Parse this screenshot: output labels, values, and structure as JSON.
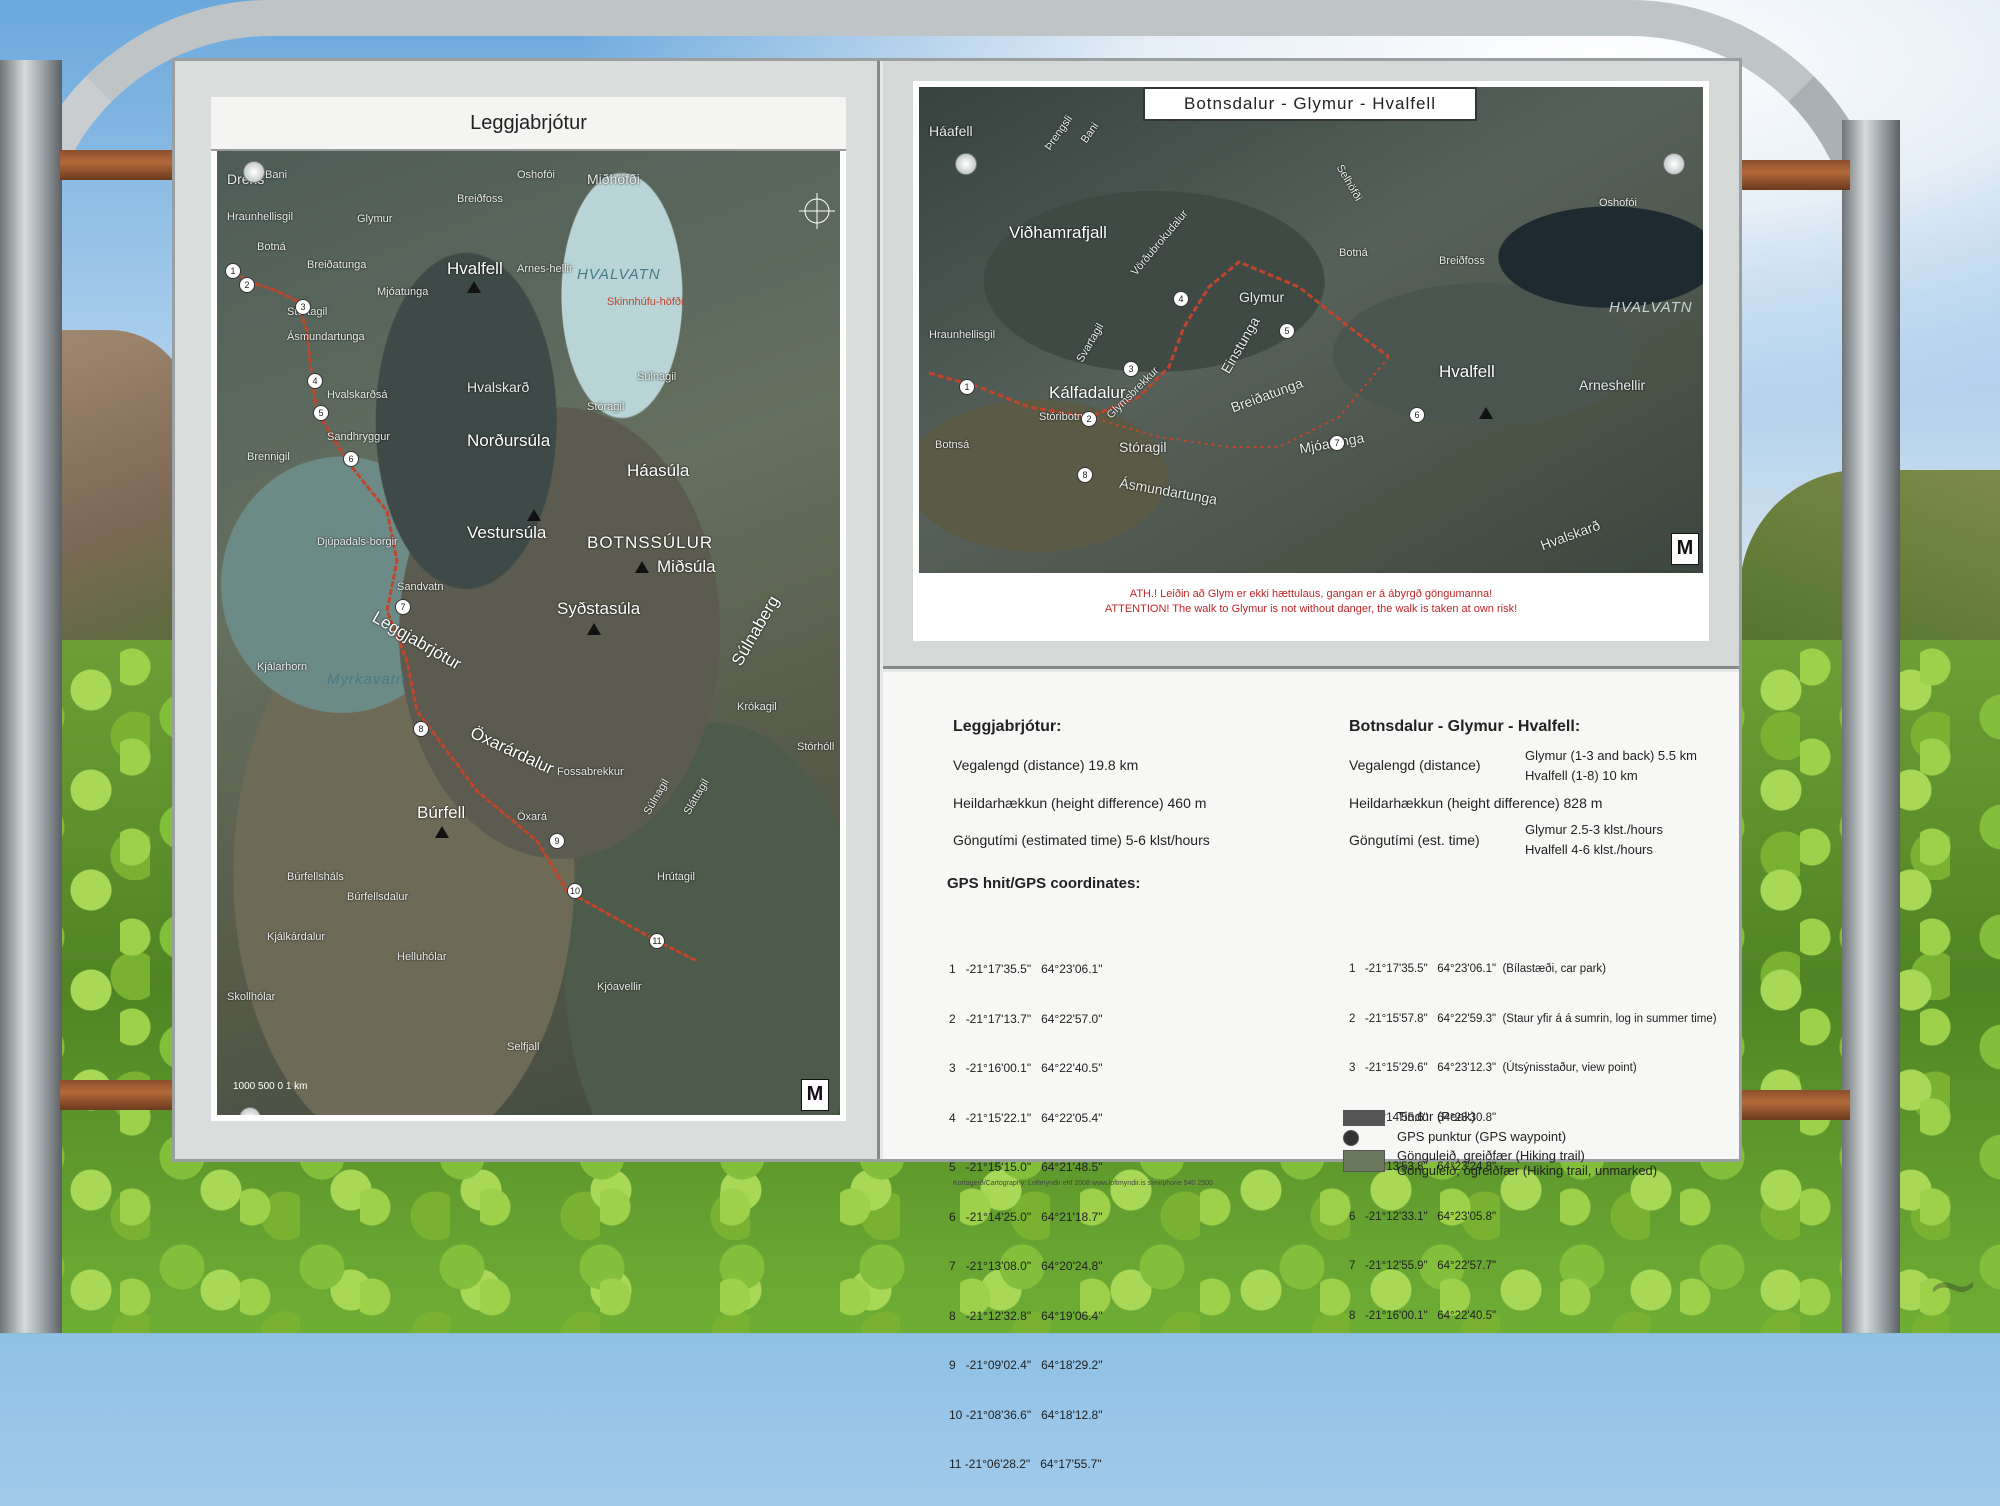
{
  "left_map": {
    "title": "Leggjabrjótur",
    "labels": {
      "drens": "Drens",
      "bani": "Bani",
      "oshofoi": "Oshofói",
      "midhofoi": "Miðhöfði",
      "hraunhellisgil": "Hraunhellisgil",
      "glymur": "Glymur",
      "breidfoss": "Breiðfoss",
      "hvalfell": "Hvalfell",
      "hvalvatn": "HVALVATN",
      "arneshellir": "Arnes-hellir",
      "skinnhufuhofdi": "Skinnhúfu-höfði",
      "stortagil": "Stórtagil",
      "breidatunga": "Breiðatunga",
      "midatunga": "Mjóatunga",
      "botna": "Botná",
      "asmundartunga": "Ásmundartunga",
      "hvalskard": "Hvalskarð",
      "hvalskardsa": "Hvalskarðsá",
      "sulnagil": "Súlnagil",
      "storagil": "Stóragil",
      "sandhryggur": "Sandhryggur",
      "nordursula": "Norðursúla",
      "haasula": "Háasúla",
      "brennigil": "Brennigil",
      "vestursula": "Vestursúla",
      "botnssulur": "BOTNSSÚLUR",
      "midsula": "Miðsúla",
      "djupadalsborgir": "Djúpadals-borgir",
      "sandvatn": "Sandvatn",
      "sydstasula": "Syðstasúla",
      "sulnaberg": "Súlnaberg",
      "leggjabrjotur": "Leggjabrjótur",
      "myrkavatn": "Myrkavatn",
      "oxarardalur": "Öxarárdalur",
      "kjalarhorn": "Kjálarhorn",
      "krokagil": "Krókagil",
      "fossabrekkur": "Fossabrekkur",
      "burfell": "Búrfell",
      "oxara": "Öxará",
      "sulnagil2": "Súlnagil",
      "slattagil": "Sláttagil",
      "stordholl": "Stórhóll",
      "burfellshals": "Búrfellsháls",
      "burfellsdalur": "Búrfellsdalur",
      "hrutagil": "Hrútagil",
      "kjalkardalur": "Kjálkárdalur",
      "skollholar": "Skollhólar",
      "helluholar": "Helluhólar",
      "kjoavellir": "Kjóavellir",
      "selfjall": "Selfjall"
    },
    "scale": "1000 500 0 1 km",
    "logo": "M",
    "waypoints": [
      "1",
      "2",
      "3",
      "4",
      "5",
      "6",
      "7",
      "8",
      "9",
      "10",
      "11"
    ]
  },
  "right_map": {
    "title": "Botnsdalur - Glymur - Hvalfell",
    "labels": {
      "haafell": "Háafell",
      "prengsli": "Þrengsli",
      "bani": "Bani",
      "oshofoi": "Oshofói",
      "vidhamrafjall": "Viðhamrafjall",
      "vordubrokudalur": "Vörðubrokudalur",
      "selhofoi": "Selhöfði",
      "botna": "Botná",
      "breidfoss": "Breiðfoss",
      "hvalvatn": "HVALVATN",
      "glymur": "Glymur",
      "hraunhellisgil": "Hraunhellisgil",
      "svartagil": "Svartagil",
      "einstunga": "Einstunga",
      "arneshellir": "Arneshellir",
      "hvalfell": "Hvalfell",
      "kalfadalur": "Kálfadalur",
      "glymsbrekkur": "Glymsbrekkur",
      "breidatunga": "Breiðatunga",
      "storibotn": "Stóribotn",
      "midatunga": "Mjóatunga",
      "storagil": "Stóragil",
      "botnsa": "Botnsá",
      "asmundartunga": "Ásmundartunga",
      "hvalskard": "Hvalskarð"
    },
    "waypoints": [
      "1",
      "2",
      "3",
      "4",
      "5",
      "6",
      "7",
      "8"
    ],
    "logo": "M",
    "warning_is": "ATH.! Leiðin að Glym er ekki hættulaus, gangan er á ábyrgð göngumanna!",
    "warning_en": "ATTENTION! The walk to Glymur is not without danger, the walk is taken at own risk!"
  },
  "info": {
    "left": {
      "heading": "Leggjabrjótur:",
      "distance": "Vegalengd (distance) 19.8 km",
      "height": "Heildarhækkun (height difference) 460 m",
      "time": "Göngutími (estimated time) 5-6 klst/hours",
      "gps_heading": "GPS hnit/GPS coordinates:",
      "coordinates": [
        "1   -21°17'35.5\"   64°23'06.1\"",
        "2   -21°17'13.7\"   64°22'57.0\"",
        "3   -21°16'00.1\"   64°22'40.5\"",
        "4   -21°15'22.1\"   64°22'05.4\"",
        "5   -21°15'15.0\"   64°21'48.5\"",
        "6   -21°14'25.0\"   64°21'18.7\"",
        "7   -21°13'08.0\"   64°20'24.8\"",
        "8   -21°12'32.8\"   64°19'06.4\"",
        "9   -21°09'02.4\"   64°18'29.2\"",
        "10 -21°08'36.6\"   64°18'12.8\"",
        "11 -21°06'28.2\"   64°17'55.7\""
      ]
    },
    "right": {
      "heading": "Botnsdalur - Glymur - Hvalfell:",
      "distance_label": "Vegalengd (distance)",
      "distance_1": "Glymur (1-3 and back) 5.5 km",
      "distance_2": "Hvalfell (1-8) 10 km",
      "height": "Heildarhækkun (height difference) 828 m",
      "time_label": "Göngutími (est. time)",
      "time_1": "Glymur 2.5-3 klst./hours",
      "time_2": "Hvalfell 4-6 klst./hours",
      "coordinates": [
        "1   -21°17'35.5\"   64°23'06.1\"  (Bílastæði, car park)",
        "2   -21°15'57.8\"   64°22'59.3\"  (Staur yfir á á sumrin, log in summer time)",
        "3   -21°15'29.6\"   64°23'12.3\"  (Útsýnisstaður, view point)",
        "4   -21°14'55.6\"   64°23'30.8\"",
        "5   -21°13'53.8\"   64°23'24.8\"",
        "6   -21°12'33.1\"   64°23'05.8\"",
        "7   -21°12'55.9\"   64°22'57.7\"",
        "8   -21°16'00.1\"   64°22'40.5\""
      ]
    },
    "legend": {
      "peak": "Tindur (Peak)",
      "gps": "GPS punktur (GPS waypoint)",
      "trail": "Gönguleið, greiðfær (Hiking trail)",
      "trail_unmarked": "Gönguleið, ógreiðfær (Hiking trail, unmarked)"
    },
    "credits": "Kortagerð/Cartography: Loftmyndir ehf 2008     www.loftmyndir.is     sími/phone 540 2500"
  },
  "colors": {
    "route": "#c0452a",
    "warning": "#c0262a"
  }
}
